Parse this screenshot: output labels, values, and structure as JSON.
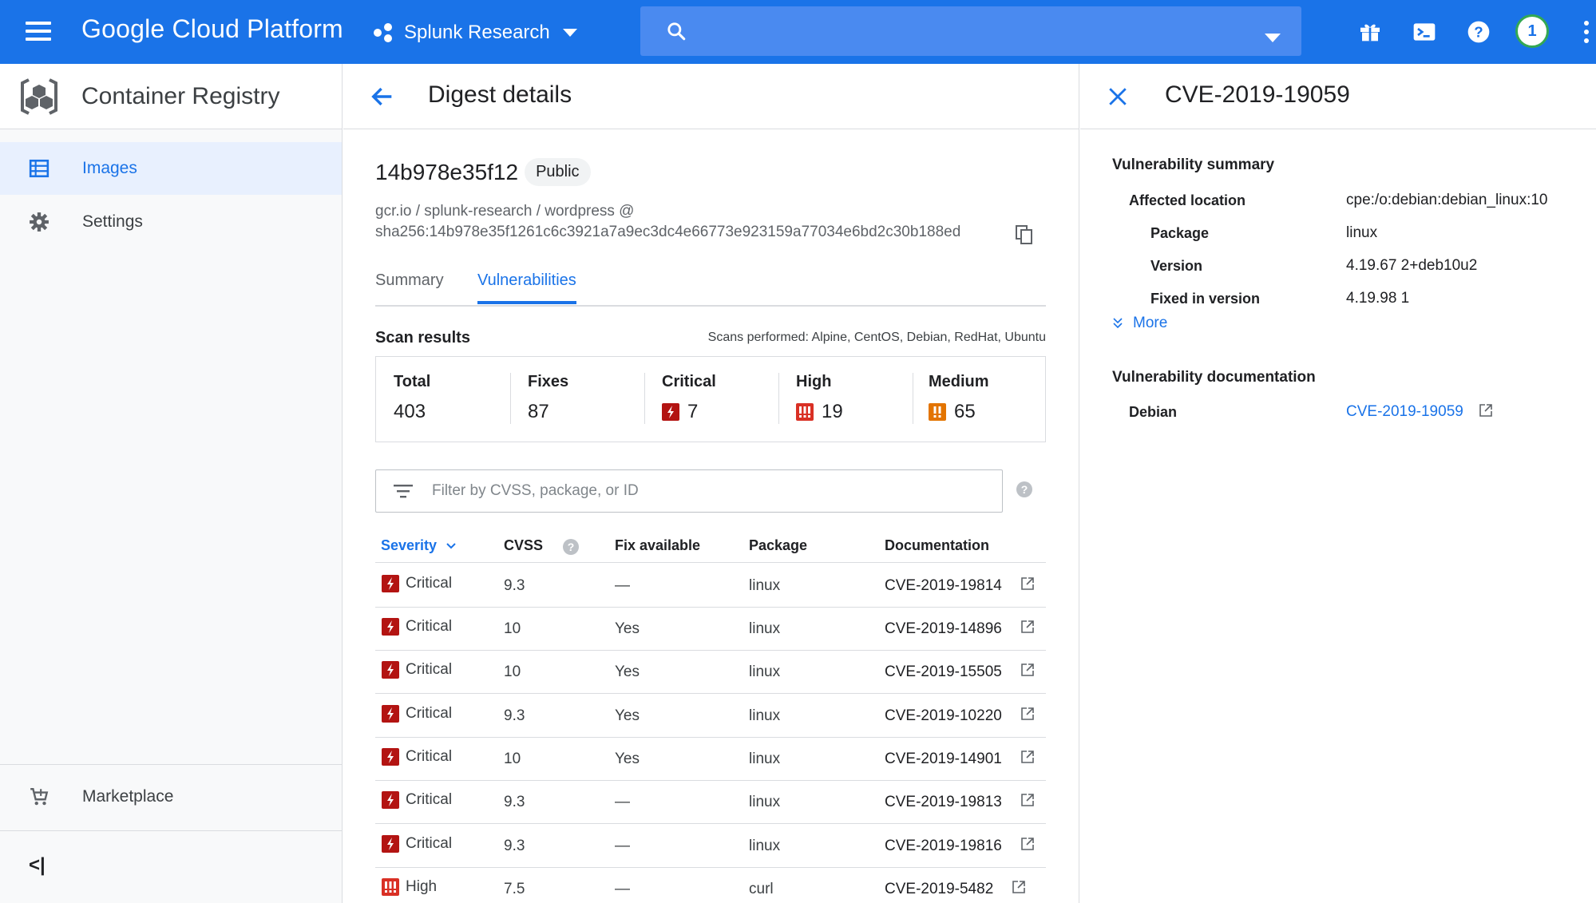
{
  "topbar": {
    "brand": "Google Cloud Platform",
    "project": "Splunk Research",
    "search_placeholder": "",
    "avatar_label": "1"
  },
  "leftnav": {
    "product": "Container Registry",
    "items": [
      {
        "label": "Images",
        "icon": "list-icon",
        "active": true
      },
      {
        "label": "Settings",
        "icon": "gear-icon",
        "active": false
      }
    ],
    "marketplace": "Marketplace",
    "collapse_label": "<|"
  },
  "digest": {
    "page_title": "Digest details",
    "hash": "14b978e35f12",
    "visibility": "Public",
    "path": "gcr.io / splunk-research / wordpress @",
    "sha": "sha256:14b978e35f1261c6c3921a7a9ec3dc4e66773e923159a77034e6bd2c30b188ed",
    "tabs": [
      {
        "label": "Summary",
        "active": false
      },
      {
        "label": "Vulnerabilities",
        "active": true
      }
    ]
  },
  "scan": {
    "title": "Scan results",
    "performed": "Scans performed: Alpine, CentOS, Debian, RedHat, Ubuntu",
    "stats": [
      {
        "label": "Total",
        "value": "403",
        "severity": ""
      },
      {
        "label": "Fixes",
        "value": "87",
        "severity": ""
      },
      {
        "label": "Critical",
        "value": "7",
        "severity": "critical"
      },
      {
        "label": "High",
        "value": "19",
        "severity": "high"
      },
      {
        "label": "Medium",
        "value": "65",
        "severity": "medium"
      }
    ]
  },
  "filter": {
    "placeholder": "Filter by CVSS, package, or ID"
  },
  "table": {
    "headers": {
      "severity": "Severity",
      "cvss": "CVSS",
      "fix": "Fix available",
      "package": "Package",
      "doc": "Documentation"
    },
    "rows": [
      {
        "severity": "Critical",
        "cvss": "9.3",
        "fix": "—",
        "package": "linux",
        "doc": "CVE-2019-19814"
      },
      {
        "severity": "Critical",
        "cvss": "10",
        "fix": "Yes",
        "package": "linux",
        "doc": "CVE-2019-14896"
      },
      {
        "severity": "Critical",
        "cvss": "10",
        "fix": "Yes",
        "package": "linux",
        "doc": "CVE-2019-15505"
      },
      {
        "severity": "Critical",
        "cvss": "9.3",
        "fix": "Yes",
        "package": "linux",
        "doc": "CVE-2019-10220"
      },
      {
        "severity": "Critical",
        "cvss": "10",
        "fix": "Yes",
        "package": "linux",
        "doc": "CVE-2019-14901"
      },
      {
        "severity": "Critical",
        "cvss": "9.3",
        "fix": "—",
        "package": "linux",
        "doc": "CVE-2019-19813"
      },
      {
        "severity": "Critical",
        "cvss": "9.3",
        "fix": "—",
        "package": "linux",
        "doc": "CVE-2019-19816"
      },
      {
        "severity": "High",
        "cvss": "7.5",
        "fix": "—",
        "package": "curl",
        "doc": "CVE-2019-5482"
      }
    ]
  },
  "detail": {
    "title": "CVE-2019-19059",
    "summary_heading": "Vulnerability summary",
    "affected_label": "Affected location",
    "affected_value": "cpe:/o:debian:debian_linux:10",
    "package_label": "Package",
    "package_value": "linux",
    "version_label": "Version",
    "version_value": "4.19.67 2+deb10u2",
    "fixed_label": "Fixed in version",
    "fixed_value": "4.19.98 1",
    "more_label": "More",
    "doc_heading": "Vulnerability documentation",
    "doc_source": "Debian",
    "doc_link": "CVE-2019-19059"
  },
  "colors": {
    "brand_blue": "#1a73e8",
    "critical": "#b31412",
    "high": "#d93025",
    "medium": "#e37400"
  }
}
